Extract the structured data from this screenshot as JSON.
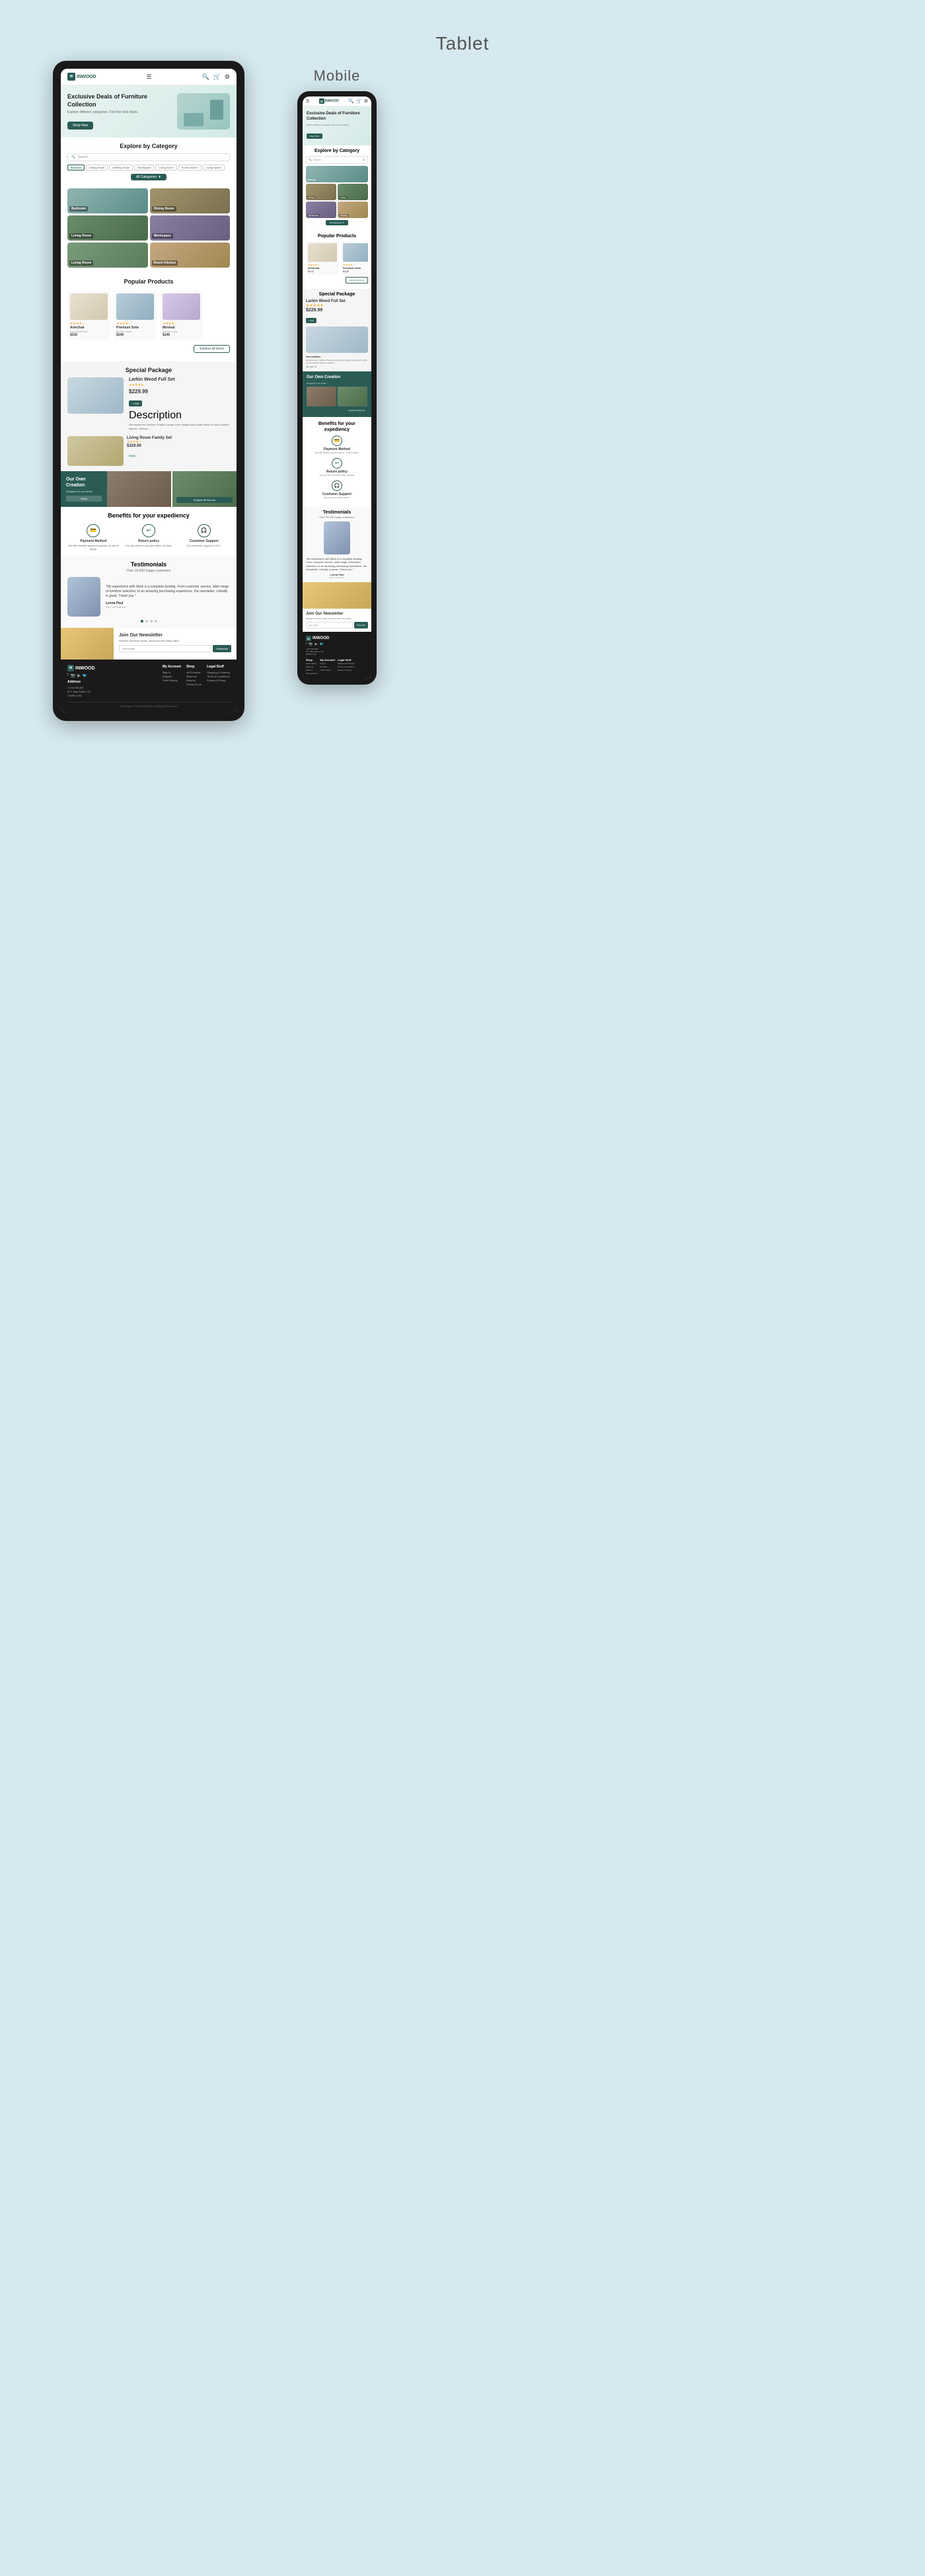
{
  "page": {
    "tablet_title": "Tablet",
    "mobile_title": "Mobile",
    "bg_color": "#d6e9f0"
  },
  "brand": {
    "name": "INWOOD",
    "logo_letter": "W"
  },
  "hero": {
    "title": "Exclusive Deals of Furniture Collection",
    "subtitle": "Explore different categories. Find the best deals.",
    "cta": "Shop Now"
  },
  "category_section": {
    "title": "Explore by Category",
    "search_placeholder": "Search",
    "tags": [
      "Bedroom",
      "Dining Room",
      "Meeting Room",
      "Workspace",
      "Living Room",
      "Room Kitchen",
      "Living Space"
    ],
    "all_categories_btn": "All Categories",
    "categories": [
      {
        "name": "Bedroom",
        "color": "cat-bedroom"
      },
      {
        "name": "Dining Room",
        "color": "cat-dining"
      },
      {
        "name": "Living Room",
        "color": "cat-living"
      },
      {
        "name": "Workspace",
        "color": "cat-workspace"
      },
      {
        "name": "Living Room",
        "color": "cat-livingroom"
      },
      {
        "name": "Room Kitchen",
        "color": "cat-kitchen"
      }
    ]
  },
  "popular_products": {
    "title": "Popular Products",
    "explore_btn": "Explore all items",
    "products": [
      {
        "name": "Armchair",
        "type": "Light Dark Red",
        "price": "$142",
        "img_class": "chair1"
      },
      {
        "name": "Premium Sofa",
        "type": "Modern style",
        "price": "$145",
        "img_class": "sofa1"
      },
      {
        "name": "Minimal",
        "type": "Modern style",
        "price": "$145",
        "img_class": "minimal"
      }
    ]
  },
  "special_package": {
    "title": "Special Package",
    "item1": {
      "name": "Larkin Wood Full Set",
      "price": "$229.99",
      "description": "Get aluminum Outdoor Chaise Lounge to an elegant and stylish touch to your outdoor spaces. Lifetime…"
    },
    "item2": {
      "name": "Living Room Family Set",
      "price": "$229.99",
      "label": "Deals"
    }
  },
  "our_creation": {
    "title": "Our Own Creation",
    "subtitle": "Designed in our studio",
    "btn": "Show",
    "explore_btn": "Explore All Rooms"
  },
  "benefits": {
    "title": "Benefits for your expediency",
    "items": [
      {
        "icon": "💳",
        "title": "Payment Method",
        "desc": "We offer flexible payment options, no terms apply."
      },
      {
        "icon": "↩",
        "title": "Return policy",
        "desc": "You can return a product within 30 days."
      },
      {
        "icon": "🎧",
        "title": "Customer Support",
        "desc": "Our customer support is 24/7."
      }
    ]
  },
  "testimonials": {
    "title": "Testimonials",
    "subtitle": "Over 15,000 happy customers",
    "quote": "\"My experience with Mark is a complete landing. From customer service, wide range of furniture selection, to an amazing purchasing experience, the newsletter. Literally is great. Thank you.\"",
    "name": "Leena Paul",
    "role": "CEO of Pinamon"
  },
  "newsletter": {
    "title": "Join Our Newsletter",
    "subtitle": "Receive exclusive deals, discounts and many offers.",
    "input_placeholder": "Your email",
    "btn": "Subscribe"
  },
  "footer": {
    "logo": "INWOOD",
    "address": {
      "line1": "+123-456-567",
      "line2": "877, Bay Street, NY",
      "line3": "14068, USA"
    },
    "my_account": {
      "title": "My Account",
      "links": [
        "Sign in",
        "Register",
        "Order history"
      ]
    },
    "shop": {
      "title": "Shop",
      "links": [
        "All Products",
        "Bedroom",
        "Returns",
        "Dining Room"
      ]
    },
    "shipping": {
      "title": "Shop",
      "links": [
        "Shipping & Delivery",
        "Terms & Conditions",
        "Privacy & Policy"
      ]
    },
    "legal": {
      "title": "Legal Stuff",
      "links": [
        "Shipping & Delivery",
        "Terms & Conditions",
        "Privacy & Policy"
      ]
    },
    "copyright": "Copyright © 2022 INWOOD, All Rights Reserved"
  },
  "dots": {
    "items": [
      "active",
      "inactive",
      "inactive",
      "inactive"
    ]
  }
}
